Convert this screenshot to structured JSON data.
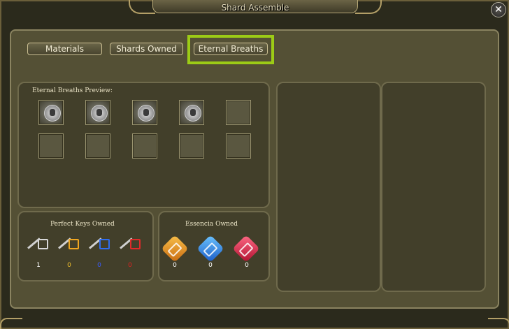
{
  "window": {
    "title": "Shard Assemble"
  },
  "tabs": [
    {
      "label": "Materials",
      "active": false
    },
    {
      "label": "Shards Owned",
      "active": false
    },
    {
      "label": "Eternal Breaths",
      "active": true
    }
  ],
  "preview": {
    "heading": "Eternal Breaths Preview:",
    "slots": [
      {
        "icon": "eternal-breath-emblem-icon"
      },
      {
        "icon": "eternal-breath-emblem-icon"
      },
      {
        "icon": "eternal-breath-emblem-icon"
      },
      {
        "icon": "eternal-breath-emblem-icon"
      },
      {
        "icon": null
      },
      {
        "icon": null
      },
      {
        "icon": null
      },
      {
        "icon": null
      },
      {
        "icon": null
      },
      {
        "icon": null
      }
    ]
  },
  "keys": {
    "heading": "Perfect Keys Owned",
    "items": [
      {
        "icon": "silver-key-icon",
        "count": "1",
        "color": "#ffffff"
      },
      {
        "icon": "gold-key-icon",
        "count": "0",
        "color": "#f2c12e"
      },
      {
        "icon": "blue-key-icon",
        "count": "0",
        "color": "#3a5cff"
      },
      {
        "icon": "red-key-icon",
        "count": "0",
        "color": "#e02020"
      }
    ]
  },
  "essence": {
    "heading": "Essencia Owned",
    "items": [
      {
        "icon": "orange-essence-gem-icon",
        "count": "0",
        "color": "#f0a020"
      },
      {
        "icon": "blue-essence-gem-icon",
        "count": "0",
        "color": "#2a86e8"
      },
      {
        "icon": "red-essence-gem-icon",
        "count": "0",
        "color": "#e0264a"
      }
    ]
  },
  "colors": {
    "highlight": "#9ccb16",
    "panel": "#545035"
  }
}
